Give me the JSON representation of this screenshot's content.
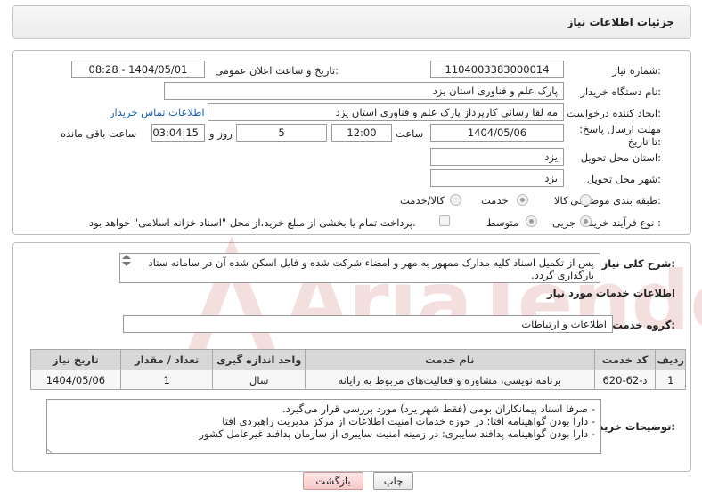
{
  "header": {
    "title": "جزئیات اطلاعات نیاز"
  },
  "fields": {
    "need_number_label": "شماره نیاز:",
    "need_number": "1104003383000014",
    "announce_label": "تاریخ و ساعت اعلان عمومی:",
    "announce_value": "1404/05/01 - 08:28",
    "buyer_org_label": "نام دستگاه خریدار:",
    "buyer_org": "پارک علم و فناوری استان یزد",
    "requester_label": "ایجاد کننده درخواست:",
    "requester": "مه لقا رسائی  کارپرداز پارک علم و فناوری استان یزد",
    "contact_link": "اطلاعات تماس خریدار",
    "deadline_label": "مهلت ارسال پاسخ: تا تاریخ:",
    "deadline_date": "1404/05/06",
    "time_label": "ساعت",
    "deadline_time": "12:00",
    "days_value": "5",
    "days_label": "روز و",
    "remaining_time": "03:04:15",
    "remaining_label": "ساعت باقی مانده",
    "province_label": "استان محل تحویل:",
    "province": "یزد",
    "city_label": "شهر محل تحویل:",
    "city": "یزد",
    "category_label": "طبقه بندی موضوعی:",
    "category_options": [
      "کالا",
      "خدمت",
      "کالا/خدمت"
    ],
    "category_selected": "خدمت",
    "process_label": "نوع فرآیند خرید :",
    "process_options": [
      "جزیی",
      "متوسط"
    ],
    "process_selected": "جزیی",
    "payment_note": "پرداخت تمام یا بخشی از مبلغ خرید،از محل \"اسناد خزانه اسلامی\" خواهد بود."
  },
  "summary": {
    "label": "شرح کلی نیاز:",
    "text": "پس از تکمیل اسناد  کلیه مدارک ممهور به مهر و امضاء شرکت شده و فایل اسکن شده آن  در سامانه ستاد بارگذاری گردد."
  },
  "services": {
    "section_title": "اطلاعات خدمات مورد نیاز",
    "group_label": "گروه خدمت:",
    "group_value": "اطلاعات و ارتباطات",
    "columns": [
      "ردیف",
      "کد خدمت",
      "نام خدمت",
      "واحد اندازه گیری",
      "تعداد / مقدار",
      "تاریخ نیاز"
    ],
    "rows": [
      [
        "1",
        "د-62-620",
        "برنامه نویسی، مشاوره و فعالیت‌های مربوط به رایانه",
        "سال",
        "1",
        "1404/05/06"
      ]
    ]
  },
  "buyer_notes": {
    "label": "توضیحات خریدار:",
    "lines": [
      "- صرفا اسناد پیمانکاران بومی (فقط شهر یزد) مورد بررسی قرار می‌گیرد.",
      "- دارا بودن گواهینامه افتا: در حوزه خدمات امنیت اطلاعات از مرکز مدیریت راهبردی افتا",
      "- دارا بودن گواهینامه پدافند سایبری: در زمینه امنیت سایبری از سازمان پدافند غیرعامل کشور"
    ]
  },
  "buttons": {
    "print": "چاپ",
    "back": "بازگشت"
  },
  "watermark": {
    "text": "AriaTender.neT"
  }
}
